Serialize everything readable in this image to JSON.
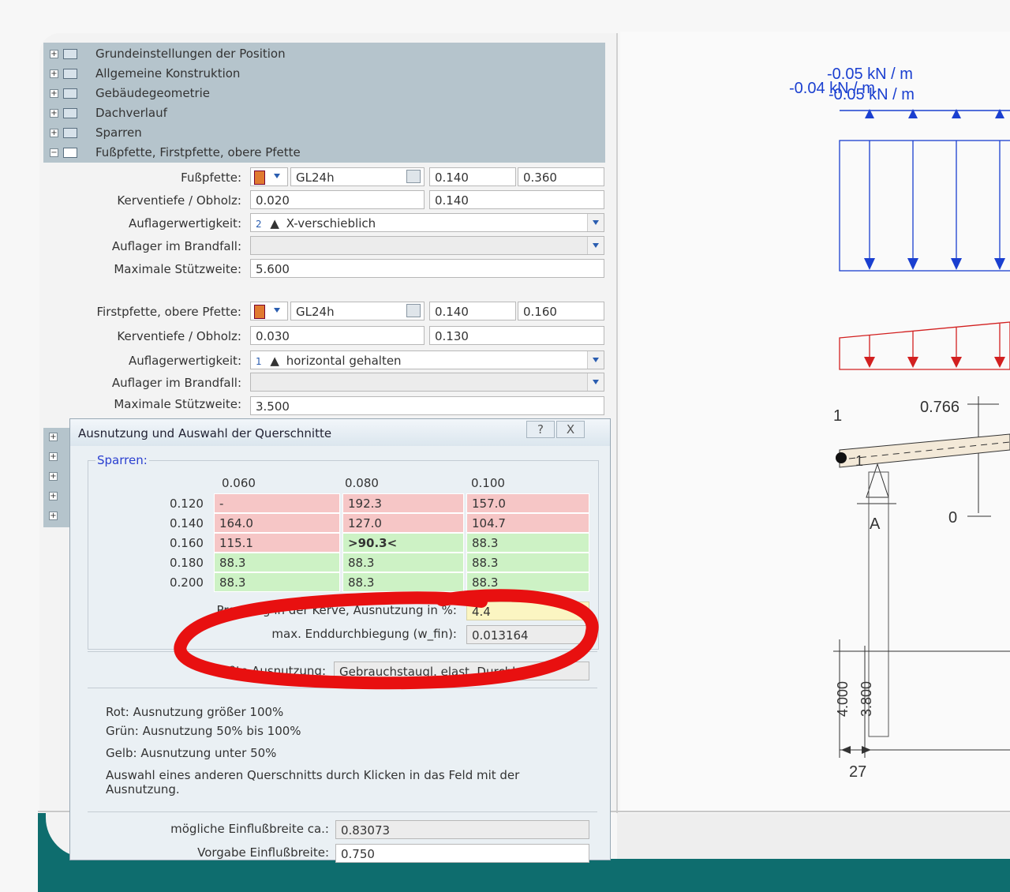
{
  "tree": {
    "items": [
      {
        "label": "Grundeinstellungen der Position",
        "expanded": false
      },
      {
        "label": "Allgemeine Konstruktion",
        "expanded": false
      },
      {
        "label": "Gebäudegeometrie",
        "expanded": false
      },
      {
        "label": "Dachverlauf",
        "expanded": false
      },
      {
        "label": "Sparren",
        "expanded": false
      },
      {
        "label": "Fußpfette, Firstpfette, obere Pfette",
        "expanded": true
      }
    ]
  },
  "fuss": {
    "label": "Fußpfette:",
    "material": "GL24h",
    "b": "0.140",
    "h": "0.360",
    "kerv_label": "Kerventiefe / Obholz:",
    "kerv": "0.020",
    "obholz": "0.140",
    "aufl_label": "Auflagerwertigkeit:",
    "aufl_num": "2",
    "aufl_text": "X-verschieblich",
    "brand_label": "Auflager im Brandfall:",
    "brand_value": "",
    "stutz_label": "Maximale Stützweite:",
    "stutz": "5.600"
  },
  "first": {
    "label": "Firstpfette, obere Pfette:",
    "material": "GL24h",
    "b": "0.140",
    "h": "0.160",
    "kerv_label": "Kerventiefe / Obholz:",
    "kerv": "0.030",
    "obholz": "0.130",
    "aufl_label": "Auflagerwertigkeit:",
    "aufl_num": "1",
    "aufl_text": "horizontal gehalten",
    "brand_label": "Auflager im Brandfall:",
    "brand_value": "",
    "stutz_label": "Maximale Stützweite:",
    "stutz": "3.500"
  },
  "dialog": {
    "title": "Ausnutzung und Auswahl der Querschnitte",
    "help_btn": "?",
    "close_btn": "X",
    "group_label": "Sparren:",
    "col_headers": [
      "0.060",
      "0.080",
      "0.100"
    ],
    "rows": [
      {
        "h": "0.120",
        "cells": [
          {
            "v": "-",
            "c": "red"
          },
          {
            "v": "192.3",
            "c": "red"
          },
          {
            "v": "157.0",
            "c": "red"
          }
        ]
      },
      {
        "h": "0.140",
        "cells": [
          {
            "v": "164.0",
            "c": "red"
          },
          {
            "v": "127.0",
            "c": "red"
          },
          {
            "v": "104.7",
            "c": "red"
          }
        ]
      },
      {
        "h": "0.160",
        "cells": [
          {
            "v": "115.1",
            "c": "red"
          },
          {
            "v": ">90.3<",
            "c": "green"
          },
          {
            "v": "88.3",
            "c": "green"
          }
        ]
      },
      {
        "h": "0.180",
        "cells": [
          {
            "v": "88.3",
            "c": "green"
          },
          {
            "v": "88.3",
            "c": "green"
          },
          {
            "v": "88.3",
            "c": "green"
          }
        ]
      },
      {
        "h": "0.200",
        "cells": [
          {
            "v": "88.3",
            "c": "green"
          },
          {
            "v": "88.3",
            "c": "green"
          },
          {
            "v": "88.3",
            "c": "green"
          }
        ]
      }
    ],
    "pressung_label": "Pressung in der Kerve, Ausnutzung in %:",
    "pressung_value": "4.4",
    "durchb_label": "max. Enddurchbiegung (w_fin):",
    "durchb_value": "0.013164",
    "groesste_label": "Größte Ausnutzung:",
    "groesste_value": "Gebrauchstaugl. elast. Durchb.",
    "legend_red": "Rot: Ausnutzung größer 100%",
    "legend_green": "Grün: Ausnutzung 50% bis 100%",
    "legend_yellow": "Gelb: Ausnutzung unter 50%",
    "hint": "Auswahl eines anderen Querschnitts durch Klicken in das Feld mit der Ausnutzung.",
    "einfl_label": "mögliche Einflußbreite ca.:",
    "einfl_value": "0.83073",
    "vorgabe_label": "Vorgabe Einflußbreite:",
    "vorgabe_value": "0.750"
  },
  "drawing": {
    "load1": "-0.05 kN / m",
    "load2": "-0.04 kN / m",
    "load3": "-0.05 kN / m",
    "node1": "1",
    "dim1": "0.766",
    "support_a": "A",
    "zero": "0",
    "dim_4000": "4.000",
    "dim_3800": "3.800",
    "dim_27": "27",
    "node_label_small": "1"
  },
  "colors": {
    "red_cell": "#f6c6c6",
    "green_cell": "#cdf2c5",
    "yellow_cell": "#fbf5c2",
    "load_blue": "#1a3fd0",
    "load_red": "#d22020",
    "annot_red": "#e81010",
    "footer": "#0e6d6e"
  }
}
